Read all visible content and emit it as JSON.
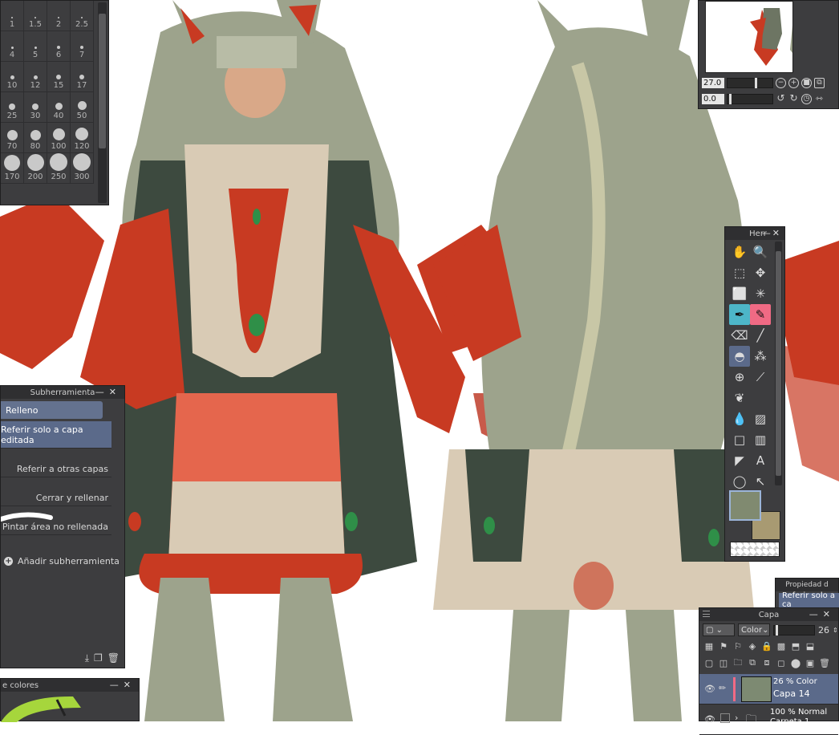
{
  "canvas": {
    "colors": {
      "hair": "#9da38c",
      "hair_dark": "#6d7563",
      "cloak": "#3d4a3f",
      "red": "#c83a22",
      "red_light": "#e5664d",
      "cream": "#d9cbb5",
      "skin": "#d9a888",
      "gem": "#2f8f48"
    }
  },
  "brush_size": {
    "sizes": [
      "1",
      "1.5",
      "2",
      "2.5",
      "4",
      "5",
      "6",
      "7",
      "10",
      "12",
      "15",
      "17",
      "25",
      "30",
      "40",
      "50",
      "70",
      "80",
      "100",
      "120",
      "170",
      "200",
      "250",
      "300"
    ]
  },
  "subtool_panel": {
    "title": "Subherramienta",
    "active_subtool": "Relleno",
    "items": [
      "Referir solo a capa editada",
      "Referir a otras capas",
      "Cerrar y rellenar",
      "Pintar área no rellenada"
    ],
    "add_label": "Añadir subherramienta"
  },
  "navigator": {
    "zoom": "27.0",
    "rotation": "0.0"
  },
  "tool_panel": {
    "title": "Herr",
    "main_color": "#808a70",
    "sub_color": "#a89a72"
  },
  "properties_panel": {
    "title": "Propiedad d",
    "selected_label": "Referir solo a ca"
  },
  "layer_panel": {
    "title": "Capa",
    "blend_mode": "Color",
    "opacity": "26",
    "layers": [
      {
        "opacity_mode": "26 % Color",
        "name": "Capa 14",
        "thumb": "#7d8a72"
      },
      {
        "opacity_mode": "100 % Normal",
        "name": "Carpeta 1",
        "thumb": ""
      }
    ]
  },
  "color_panel": {
    "title": "e colores"
  }
}
